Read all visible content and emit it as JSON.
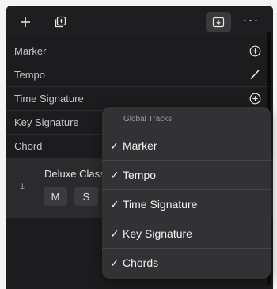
{
  "toolbar": {
    "more_label": "···"
  },
  "global_rows": [
    {
      "label": "Marker",
      "action_icon": "plus-circle-icon"
    },
    {
      "label": "Tempo",
      "action_icon": "pencil-icon"
    },
    {
      "label": "Time Signature",
      "action_icon": "plus-circle-icon"
    },
    {
      "label": "Key Signature",
      "action_icon": ""
    },
    {
      "label": "Chord",
      "action_icon": ""
    }
  ],
  "track": {
    "number": "1",
    "name": "Deluxe Classic",
    "mute_label": "M",
    "solo_label": "S"
  },
  "global_tracks_menu": {
    "header": "Global Tracks",
    "check_glyph": "✓",
    "items": [
      {
        "label": "Marker",
        "checked": true
      },
      {
        "label": "Tempo",
        "checked": true
      },
      {
        "label": "Time Signature",
        "checked": true
      },
      {
        "label": "Key Signature",
        "checked": true
      },
      {
        "label": "Chords",
        "checked": true
      }
    ]
  }
}
